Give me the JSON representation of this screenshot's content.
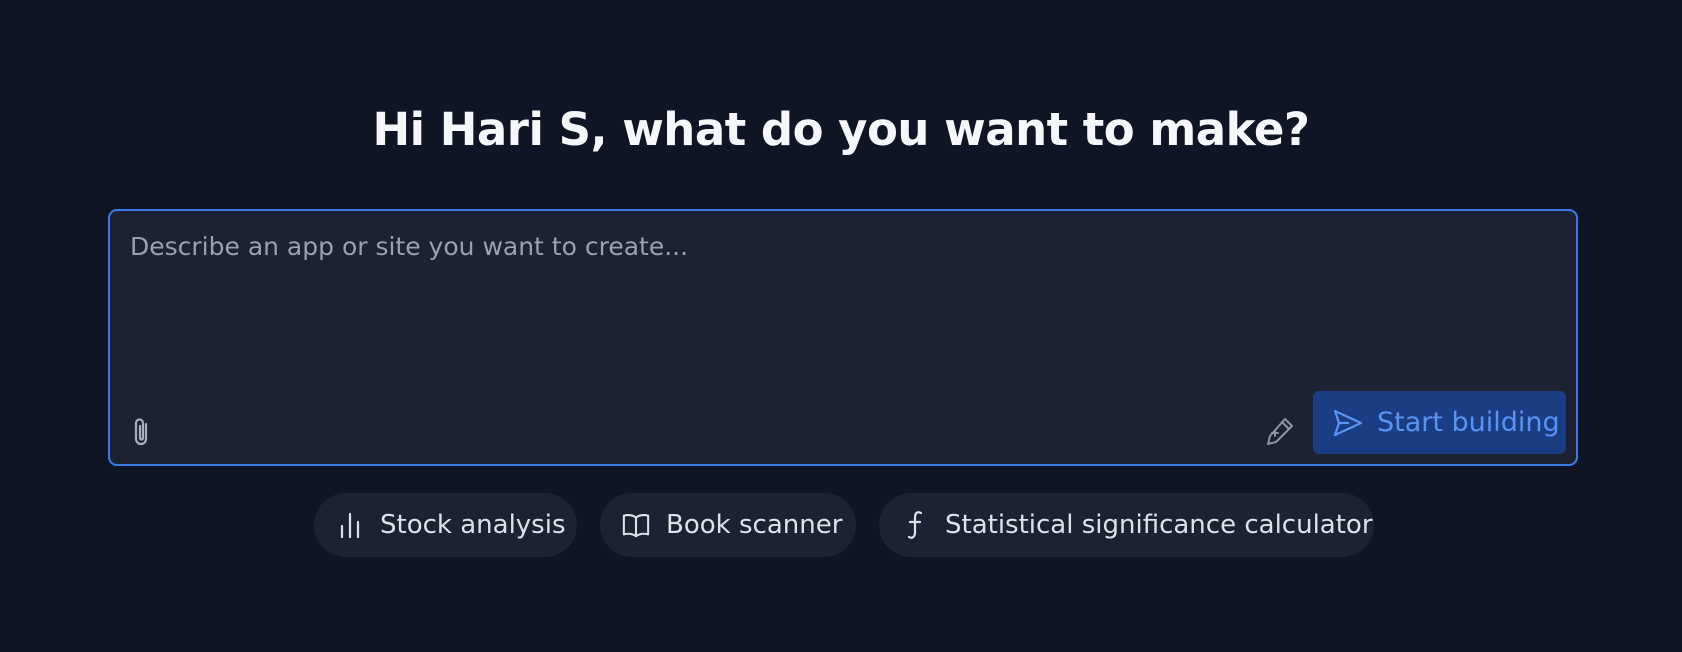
{
  "heading": "Hi Hari S, what do you want to make?",
  "prompt": {
    "placeholder": "Describe an app or site you want to create...",
    "value": ""
  },
  "actions": {
    "attach_icon": "paperclip-icon",
    "enhance_icon": "pen-sparkle-icon",
    "start_label": "Start building",
    "start_icon": "send-icon"
  },
  "suggestions": [
    {
      "label": "Stock analysis",
      "icon": "bar-chart-icon"
    },
    {
      "label": "Book scanner",
      "icon": "open-book-icon"
    },
    {
      "label": "Statistical significance calculator",
      "icon": "function-icon"
    }
  ],
  "colors": {
    "background": "#0f1525",
    "panel": "#1d2233",
    "accent": "#3b7ae8",
    "button_bg": "#1b3d84",
    "button_text": "#5a93f2"
  }
}
